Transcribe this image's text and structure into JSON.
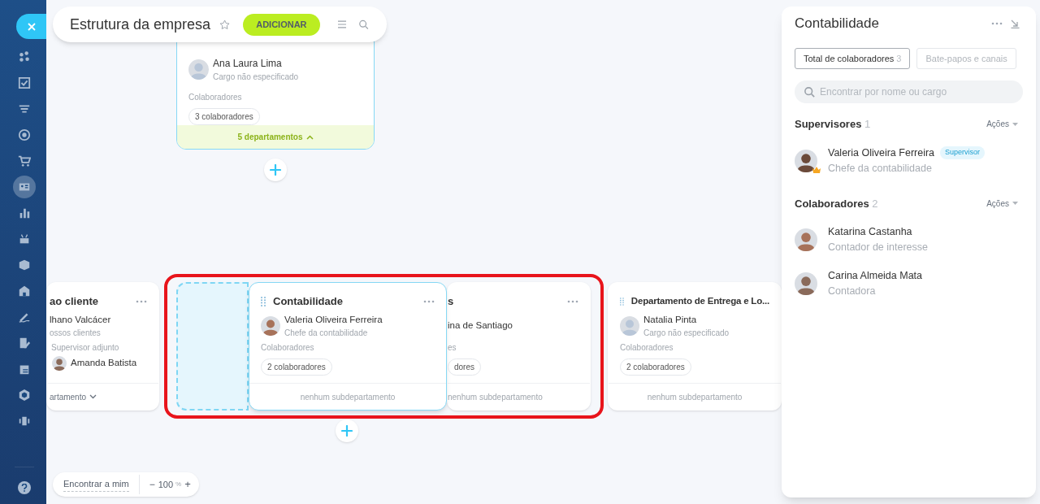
{
  "sidebar": {
    "items": [
      {
        "selected": false
      },
      {
        "selected": false
      },
      {
        "selected": false
      },
      {
        "selected": false
      },
      {
        "selected": false
      },
      {
        "selected": true
      },
      {
        "selected": false
      },
      {
        "selected": false
      },
      {
        "selected": false
      },
      {
        "selected": false
      },
      {
        "selected": false
      },
      {
        "selected": false
      },
      {
        "selected": false
      },
      {
        "selected": false
      },
      {
        "selected": false
      }
    ]
  },
  "header": {
    "title": "Estrutura da empresa",
    "add_button": "ADICIONAR"
  },
  "top_card": {
    "name": "Ana Laura Lima",
    "position": "Cargo não especificado",
    "employees_label": "Colaboradores",
    "employees_count": "3 colaboradores",
    "footer": "5 departamentos",
    "expanded": true
  },
  "cards": [
    {
      "kind": "department",
      "selected": false,
      "title": "ao cliente",
      "name": "lhano Valcácer",
      "position": "ossos clientes",
      "deputy_label": "Supervisor adjunto",
      "deputy_name": "Amanda Batista",
      "footer": "artamento",
      "expanded": false
    },
    {
      "kind": "placeholder"
    },
    {
      "kind": "department",
      "selected": true,
      "title": "Contabilidade",
      "name": "Valeria Oliveira Ferreira",
      "position": "Chefe da contabilidade",
      "employees_label": "Colaboradores",
      "employees_count": "2 colaboradores",
      "footer": "nenhum subdepartamento"
    },
    {
      "kind": "department",
      "selected": false,
      "title": "s",
      "name": "ina de Santiago",
      "employees_label": "es",
      "employees_count": "dores",
      "footer": "nenhum subdepartamento"
    },
    {
      "kind": "department",
      "selected": false,
      "title": "Departamento de Entrega e Lo...",
      "name": "Natalia Pinta",
      "position": "Cargo não especificado",
      "employees_label": "Colaboradores",
      "employees_count": "2 colaboradores",
      "footer": "nenhum subdepartamento"
    }
  ],
  "highlight_frame": true,
  "zoom_bar": {
    "find_me": "Encontrar a mim",
    "minus": "−",
    "level": "100",
    "unit": "%",
    "plus": "+"
  },
  "panel": {
    "title": "Contabilidade",
    "tabs": [
      {
        "label": "Total de colaboradores",
        "count": "3",
        "selected": true
      },
      {
        "label": "Bate-papos e canais",
        "selected": false
      }
    ],
    "search": {
      "placeholder": "Encontrar por nome ou cargo"
    },
    "sections": [
      {
        "title": "Supervisores",
        "count": "1",
        "actions": "Ações",
        "people": [
          {
            "name": "Valeria Oliveira Ferreira",
            "position": "Chefe da contabilidade",
            "badge": "Supervisor",
            "crown": true
          }
        ]
      },
      {
        "title": "Colaboradores",
        "count": "2",
        "actions": "Ações",
        "people": [
          {
            "name": "Katarina Castanha",
            "position": "Contador de interesse",
            "crown": false
          },
          {
            "name": "Carina Almeida Mata",
            "position": "Contadora",
            "crown": false
          }
        ]
      }
    ]
  }
}
